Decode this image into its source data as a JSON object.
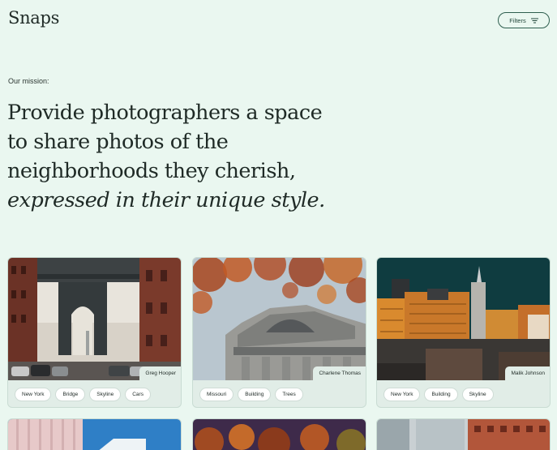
{
  "header": {
    "logo": "Snaps",
    "filters_label": "Filters"
  },
  "mission": {
    "label": "Our mission:",
    "lines": [
      "Provide photographers a space",
      "to share photos of the",
      "neighborhoods they cherish,"
    ],
    "italic_line": "expressed in their unique style."
  },
  "cards": [
    {
      "author": "Greg Hooper",
      "tags": [
        "New York",
        "Bridge",
        "Skyline",
        "Cars"
      ],
      "photo": "bridge-photo"
    },
    {
      "author": "Charlene Thomas",
      "tags": [
        "Missouri",
        "Building",
        "Trees"
      ],
      "photo": "building-trees-photo"
    },
    {
      "author": "Malik Johnson",
      "tags": [
        "New York",
        "Building",
        "Skyline"
      ],
      "photo": "skyline-photo"
    }
  ],
  "icons": {
    "filters": "filter-lines-icon"
  },
  "colors": {
    "background": "#eaf7f0",
    "accent": "#2e5e4e",
    "card": "#e1ede7"
  }
}
